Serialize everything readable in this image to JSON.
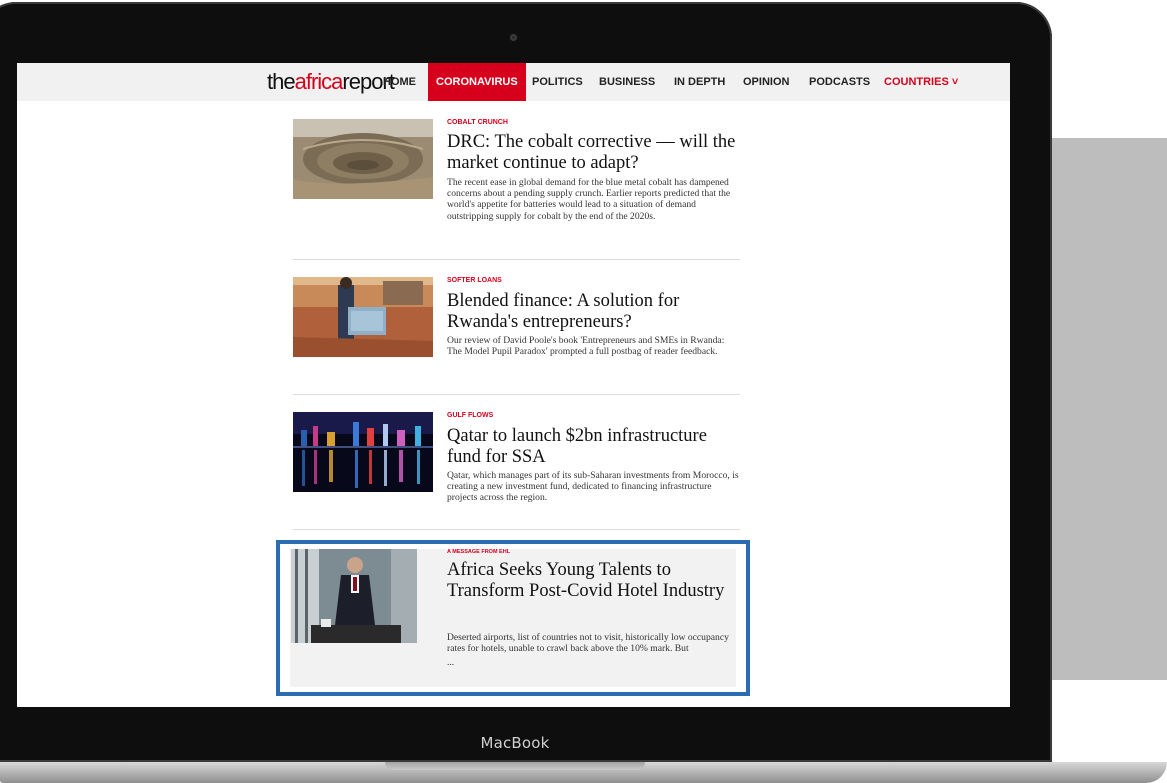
{
  "device": {
    "brand_label": "MacBook"
  },
  "site": {
    "logo": {
      "part1": "the",
      "part2": "africa",
      "part3": "report"
    },
    "nav": [
      {
        "label": "HOME",
        "active": false
      },
      {
        "label": "CORONAVIRUS",
        "active": true
      },
      {
        "label": "POLITICS",
        "active": false
      },
      {
        "label": "BUSINESS",
        "active": false
      },
      {
        "label": "IN DEPTH",
        "active": false
      },
      {
        "label": "OPINION",
        "active": false
      },
      {
        "label": "PODCASTS",
        "active": false
      },
      {
        "label": "COUNTRIES ˅",
        "active": false
      }
    ]
  },
  "articles": [
    {
      "kicker": "COBALT CRUNCH",
      "headline": "DRC: The cobalt corrective — will the market continue to adapt?",
      "excerpt": "The recent ease in global demand for the blue metal cobalt has dampened concerns about a pending supply crunch. Earlier reports predicted that the world's appetite for batteries would lead to a situation of demand outstripping supply for cobalt by the end of the 2020s.",
      "image": "open-pit-mine-photo"
    },
    {
      "kicker": "SOFTER LOANS",
      "headline": "Blended finance: A solution for Rwanda's entrepreneurs?",
      "excerpt": "Our review of David Poole's book 'Entrepreneurs and SMEs in Rwanda: The Model Pupil Paradox' prompted a full postbag of reader feedback.",
      "image": "market-trader-photo"
    },
    {
      "kicker": "GULF FLOWS",
      "headline": "Qatar to launch $2bn infrastructure fund for SSA",
      "excerpt": "Qatar, which manages part of its sub-Saharan investments from Morocco, is creating a new investment fund, dedicated to financing infrastructure projects across the region.",
      "image": "city-skyline-night-photo"
    }
  ],
  "promo": {
    "kicker": "A MESSAGE FROM EHL",
    "headline": "Africa Seeks Young Talents to Transform Post-Covid Hotel Industry",
    "excerpt": "Deserted airports, list of countries not to visit, historically low occupancy rates for hotels, unable to crawl back above the 10% mark. But",
    "ellipsis": "...",
    "image": "hotel-waiter-photo",
    "highlight_color": "#2c6db2"
  },
  "colors": {
    "brand_red": "#d6001c",
    "nav_bg": "#f1f1f1"
  }
}
